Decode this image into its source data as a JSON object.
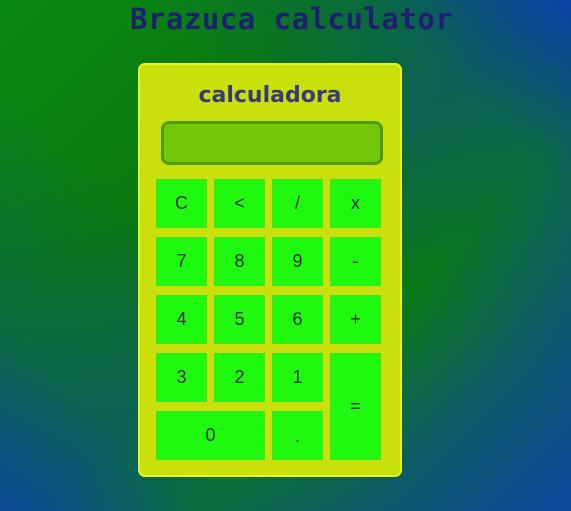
{
  "header": {
    "title": "Brazuca calculator"
  },
  "calculator": {
    "title": "calculadora",
    "display_value": "",
    "keys": {
      "clear": "C",
      "backspace": "<",
      "divide": "/",
      "multiply": "x",
      "seven": "7",
      "eight": "8",
      "nine": "9",
      "minus": "-",
      "four": "4",
      "five": "5",
      "six": "6",
      "plus": "+",
      "three": "3",
      "two": "2",
      "one": "1",
      "equals": "=",
      "zero": "0",
      "decimal": "."
    }
  },
  "colors": {
    "key_bg": "#1ef90f",
    "body_bg": "#c9e00c",
    "display_bg": "#74c80a",
    "title_color": "#1f1f72"
  }
}
